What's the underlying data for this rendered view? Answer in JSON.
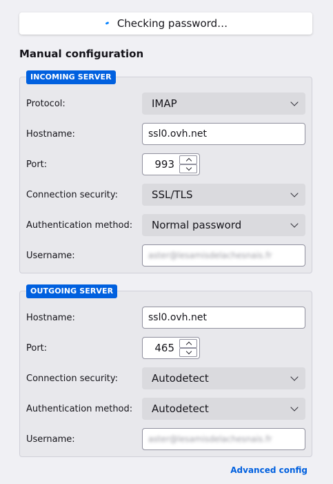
{
  "status": {
    "text": "Checking password…",
    "icon": "spinner-icon",
    "accent": "#0a84ff"
  },
  "section_title": "Manual configuration",
  "incoming": {
    "legend": "INCOMING SERVER",
    "protocol_label": "Protocol:",
    "protocol_value": "IMAP",
    "hostname_label": "Hostname:",
    "hostname_value": "ssl0.ovh.net",
    "port_label": "Port:",
    "port_value": "993",
    "security_label": "Connection security:",
    "security_value": "SSL/TLS",
    "auth_label": "Authentication method:",
    "auth_value": "Normal password",
    "username_label": "Username:",
    "username_value": "aster@lesamisdelachesnais.fr"
  },
  "outgoing": {
    "legend": "OUTGOING SERVER",
    "hostname_label": "Hostname:",
    "hostname_value": "ssl0.ovh.net",
    "port_label": "Port:",
    "port_value": "465",
    "security_label": "Connection security:",
    "security_value": "Autodetect",
    "auth_label": "Authentication method:",
    "auth_value": "Autodetect",
    "username_label": "Username:",
    "username_value": "aster@lesamisdelachesnais.fr"
  },
  "advanced_link": "Advanced config",
  "colors": {
    "legend_bg": "#0060df",
    "link": "#0060df"
  }
}
